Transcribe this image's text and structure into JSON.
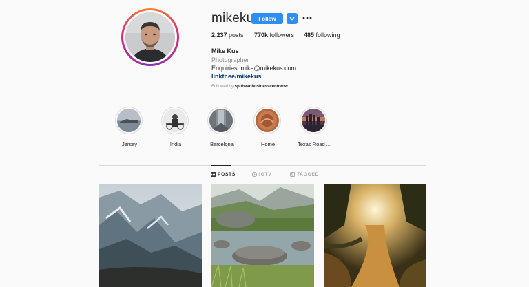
{
  "profile": {
    "username": "mikekus",
    "follow_label": "Follow",
    "posts_count": "2,237",
    "posts_label": "posts",
    "followers_count": "770k",
    "followers_label": "followers",
    "following_count": "485",
    "following_label": "following",
    "full_name": "Mike Kus",
    "category": "Photographer",
    "bio": "Enquiries: mike@mikekus.com",
    "link": "linktr.ee/mikekus",
    "followed_by_prefix": "Followed by",
    "followed_by_name": "spitheadbusinesscentreow"
  },
  "highlights": [
    {
      "label": "Jersey"
    },
    {
      "label": "India"
    },
    {
      "label": "Barcelona"
    },
    {
      "label": "Home"
    },
    {
      "label": "Texas Road ..."
    }
  ],
  "tabs": {
    "posts": "POSTS",
    "igtv": "IGTV",
    "tagged": "TAGGED"
  },
  "colors": {
    "accent": "#2e8ef4",
    "background": "#fafafa"
  }
}
